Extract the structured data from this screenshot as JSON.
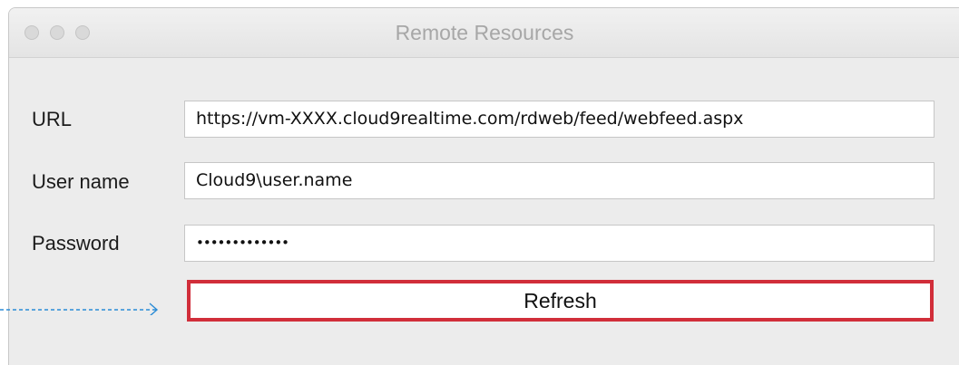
{
  "window": {
    "title": "Remote Resources"
  },
  "form": {
    "url": {
      "label": "URL",
      "value": "https://vm-XXXX.cloud9realtime.com/rdweb/feed/webfeed.aspx"
    },
    "username": {
      "label": "User name",
      "value": "Cloud9\\user.name"
    },
    "password": {
      "label": "Password",
      "value": "•••••••••••••"
    }
  },
  "refresh_label": "Refresh",
  "colors": {
    "highlight": "#d12e3a",
    "arrow": "#2a8bd6",
    "traffic_light": "#d9d9d9"
  }
}
